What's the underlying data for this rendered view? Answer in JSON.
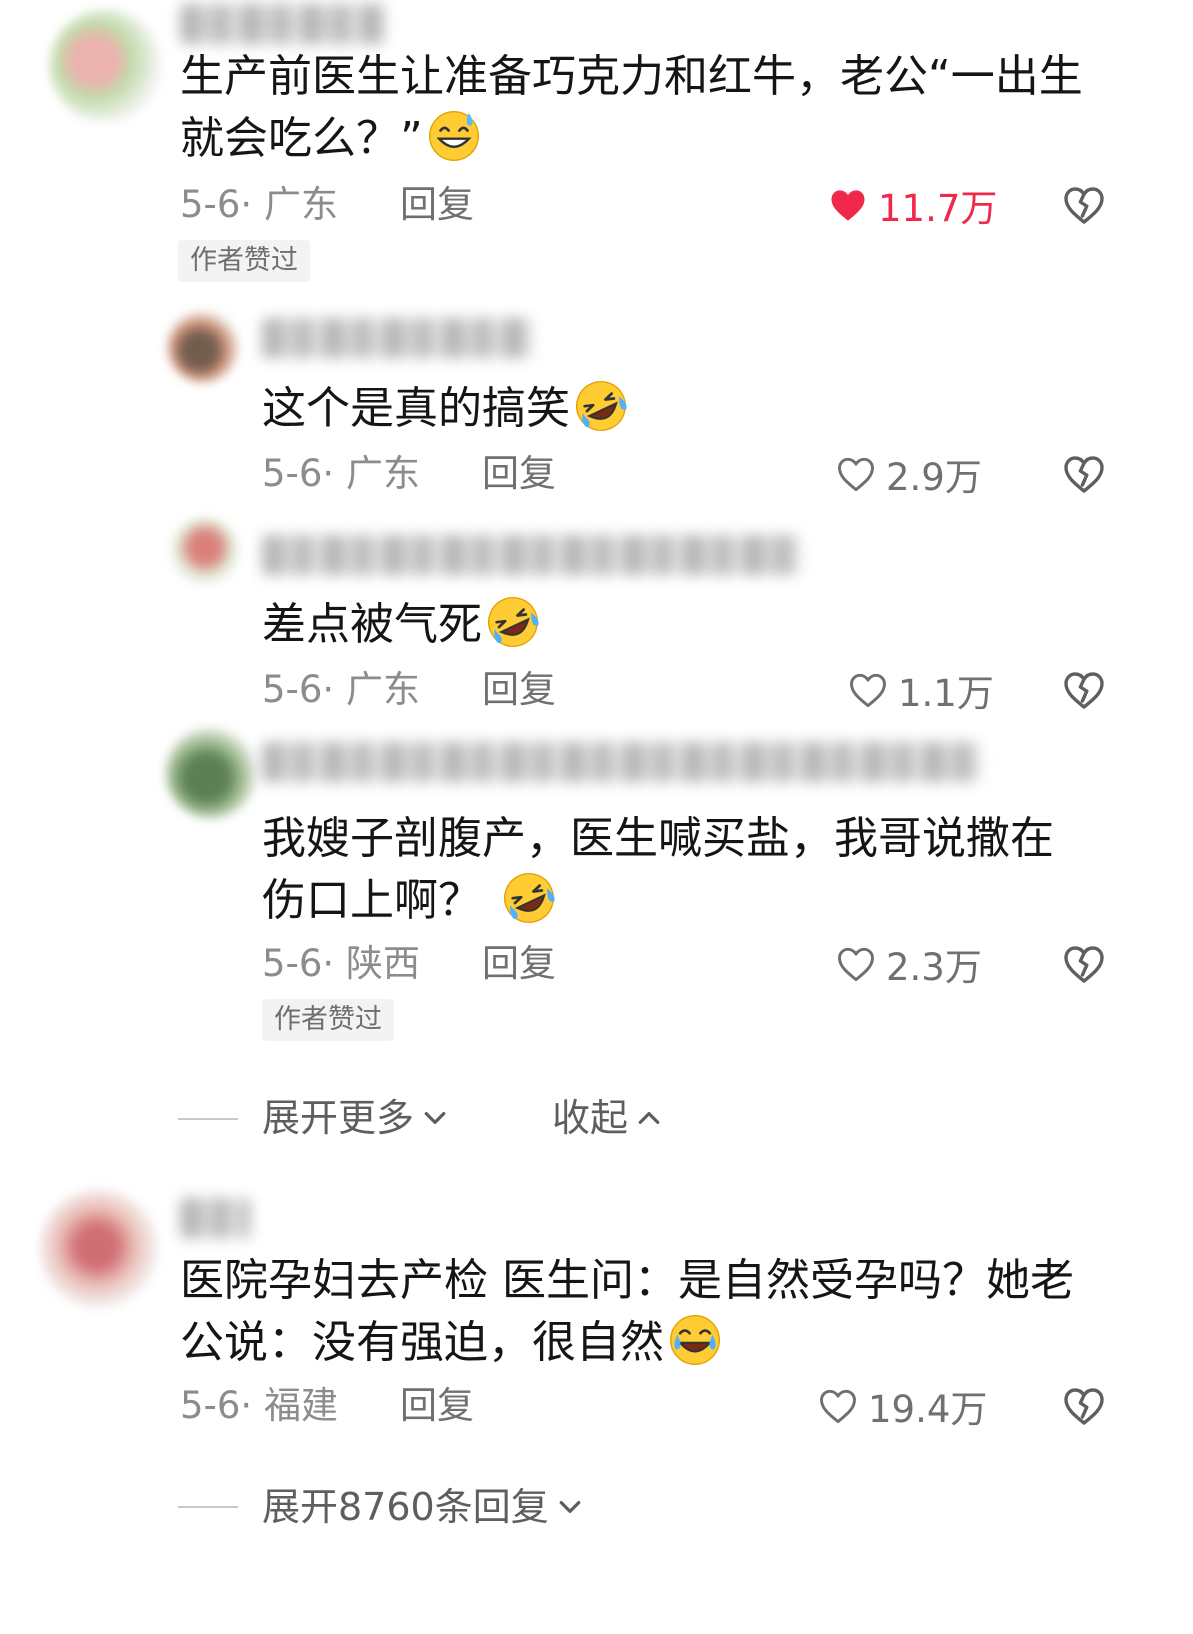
{
  "comments": [
    {
      "text_lines": [
        "生产前医生让准备巧克力和红牛，老公“一出生",
        "就会吃么？”"
      ],
      "emoji": "grinning-sweat-emoji",
      "date_location": "5-6· 广东",
      "reply_label": "回复",
      "likes": "11.7万",
      "liked": true,
      "badge": "作者赞过"
    },
    {
      "text_lines": [
        "这个是真的搞笑"
      ],
      "emoji": "rolling-laughing-emoji",
      "date_location": "5-6· 广东",
      "reply_label": "回复",
      "likes": "2.9万",
      "liked": false
    },
    {
      "text_lines": [
        "差点被气死"
      ],
      "emoji": "rolling-laughing-emoji",
      "date_location": "5-6· 广东",
      "reply_label": "回复",
      "likes": "1.1万",
      "liked": false
    },
    {
      "text_lines": [
        "我嫂子剖腹产，医生喊买盐，我哥说撒在",
        "伤口上啊？"
      ],
      "emoji": "rolling-laughing-emoji",
      "date_location": "5-6· 陕西",
      "reply_label": "回复",
      "likes": "2.3万",
      "liked": false,
      "badge": "作者赞过"
    },
    {
      "text_lines": [
        "医院孕妇去产检 医生问：是自然受孕吗？她老",
        "公说：没有强迫，很自然"
      ],
      "emoji": "tears-of-joy-emoji",
      "date_location": "5-6· 福建",
      "reply_label": "回复",
      "likes": "19.4万",
      "liked": false
    }
  ],
  "thread_controls": {
    "expand_more": "展开更多",
    "collapse": "收起"
  },
  "expand_replies": "展开8760条回复",
  "colors": {
    "like_red": "#f0284a",
    "meta_gray": "#8c8c8c",
    "badge_bg": "#f3f3f3"
  }
}
